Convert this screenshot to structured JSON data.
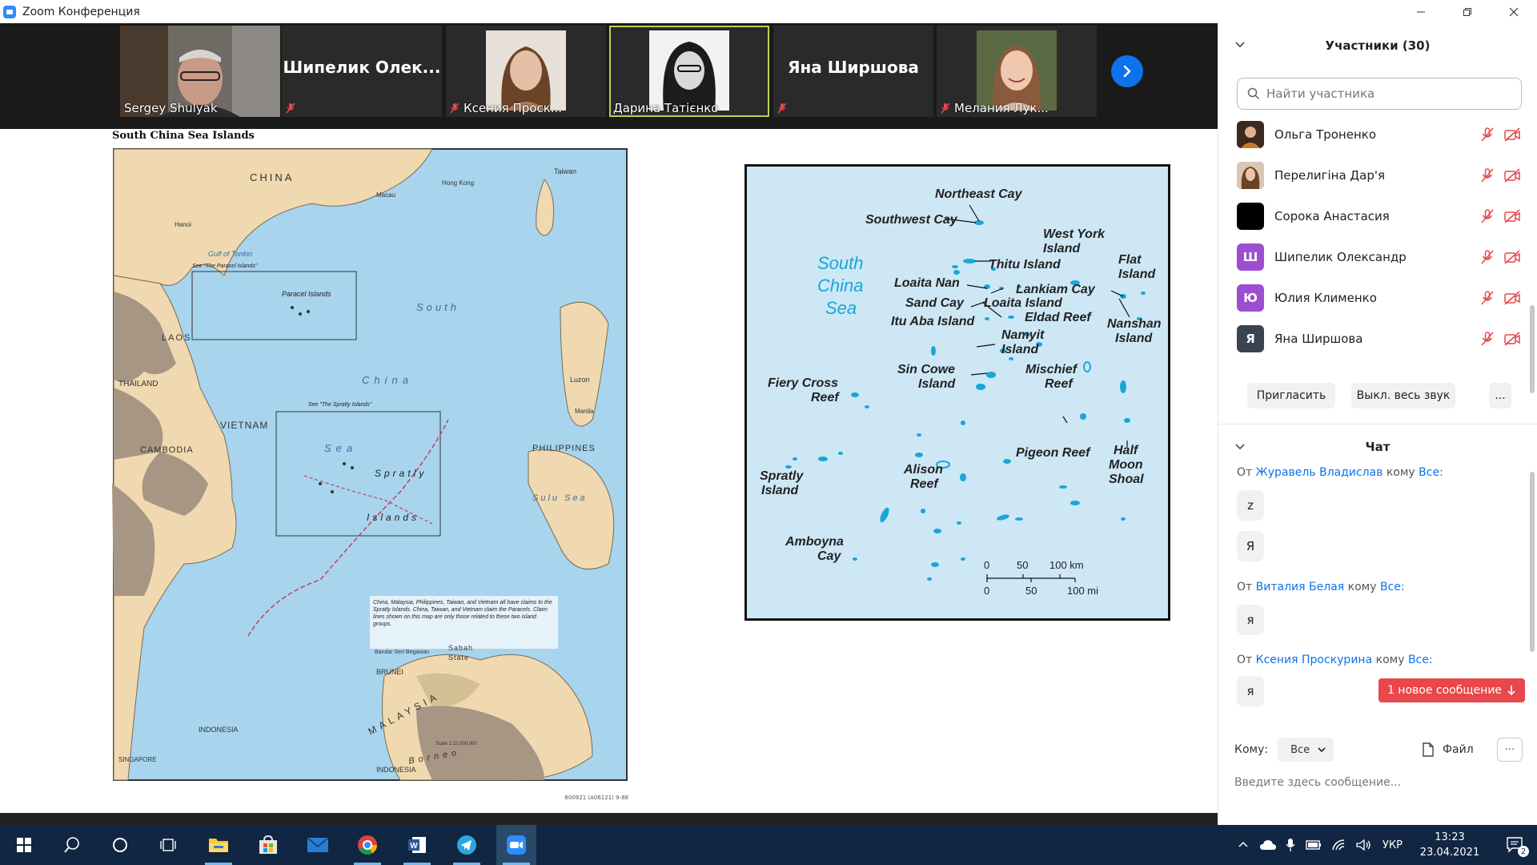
{
  "window": {
    "title": "Zoom Конференция"
  },
  "video_strip": {
    "tiles": [
      {
        "name": "Sergey Shulyak",
        "type": "video"
      },
      {
        "name": "Шипелик  Олек...",
        "type": "name",
        "muted": true
      },
      {
        "name": "Ксения Проск...",
        "type": "video",
        "muted": true
      },
      {
        "name": "Дарина Татієнко",
        "type": "video",
        "active": true
      },
      {
        "name": "Яна Ширшова",
        "type": "name",
        "muted": true
      },
      {
        "name": "Мелания Лук...",
        "type": "video",
        "muted": true
      }
    ]
  },
  "maps": {
    "left_caption": "South China Sea Islands",
    "left_labels": {
      "china": "CHINA",
      "laos": "LAOS",
      "thailand": "THAILAND",
      "vietnam": "VIETNAM",
      "cambodia": "CAMBODIA",
      "philippines": "PHILIPPINES",
      "brunei": "BRUNEI",
      "malaysia": "MALAYSIA",
      "indonesia_left": "INDONESIA",
      "indonesia_bottom": "INDONESIA",
      "singapore": "SINGAPORE",
      "taiwan": "Taiwan",
      "hong_kong": "Hong Kong",
      "macau": "Macau",
      "hanoi": "Hanoi",
      "manila": "Manila",
      "luzon": "Luzon",
      "sabah": "Sabah",
      "sabah_state": "State",
      "paracel": "Paracel Islands",
      "spratly": "Spratly",
      "islands": "Islands",
      "south": "South",
      "china_sea": "China",
      "sea": "Sea",
      "gulf_tonkin": "Gulf of Tonkin",
      "borneo": "Borneo",
      "sulu_sea": "Sulu Sea",
      "bandar": "Bandar Seri Begawan",
      "see_paracel": "See \"The Paracel Islands\"",
      "see_spratly": "See \"The Spratly Islands\"",
      "note": "China, Malaysia, Philippines, Taiwan, and Vietnam all have claims to the Spratly Islands. China, Taiwan, and Vietnam claim the Paracels. Claim lines shown on this map are only those related to these two island groups.",
      "scale": "Scale 1:12,000,000",
      "credit": "800921 (A06121) 9-88"
    },
    "right_labels": {
      "northeast_cay": "Northeast Cay",
      "southwest_cay": "Southwest Cay",
      "west_york": "West York",
      "west_york_2": "Island",
      "south": "South",
      "china": "China",
      "sea": "Sea",
      "thitu": "Thitu Island",
      "flat": "Flat",
      "flat_2": "Island",
      "loaita_nan": "Loaita Nan",
      "lankiam": "Lankiam Cay",
      "loaita_island": "Loaita Island",
      "sand_cay": "Sand Cay",
      "eldad": "Eldad Reef",
      "itu_aba": "Itu Aba Island",
      "nanshan": "Nanshan",
      "nanshan_2": "Island",
      "namyit": "Namyit",
      "namyit_2": "Island",
      "sin_cowe": "Sin Cowe",
      "sin_cowe_2": "Island",
      "mischief": "Mischief",
      "mischief_2": "Reef",
      "fiery_cross": "Fiery Cross",
      "fiery_cross_2": "Reef",
      "pigeon": "Pigeon Reef",
      "half_moon": "Half",
      "half_moon_2": "Moon",
      "half_moon_3": "Shoal",
      "alison": "Alison",
      "alison_2": "Reef",
      "spratly": "Spratly",
      "spratly_2": "Island",
      "amboyna": "Amboyna",
      "amboyna_2": "Cay",
      "scale_km": [
        "0",
        "50",
        "100 km"
      ],
      "scale_mi": [
        "0",
        "50",
        "100 mi"
      ]
    }
  },
  "participants_panel": {
    "title": "Участники (30)",
    "search_placeholder": "Найти участника",
    "participants": [
      {
        "name": "Ольга Троненко",
        "avatar_type": "photo",
        "color": "#8a5a3a"
      },
      {
        "name": "Перелигіна Дар'я",
        "avatar_type": "photo",
        "color": "#6b4e3a"
      },
      {
        "name": "Сорока Анастасия",
        "avatar_type": "solid",
        "color": "#000000"
      },
      {
        "name": "Шипелик Олександр",
        "avatar_type": "letter",
        "letter": "Ш",
        "color": "#9b4fd0"
      },
      {
        "name": "Юлия Клименко",
        "avatar_type": "letter",
        "letter": "Ю",
        "color": "#9b4fd0"
      },
      {
        "name": "Яна Ширшова",
        "avatar_type": "letter",
        "letter": "Я",
        "color": "#3a4450"
      }
    ],
    "invite_label": "Пригласить",
    "mute_all_label": "Выкл. весь звук",
    "more_label": "..."
  },
  "chat": {
    "title": "Чат",
    "from_word": "От",
    "to_word": "кому",
    "messages": [
      {
        "sender": "Журавель Владислав",
        "recipient": "Все:",
        "bubbles": [
          "z",
          "Я"
        ]
      },
      {
        "sender": "Виталия Белая",
        "recipient": "Все:",
        "bubbles": [
          "я"
        ]
      },
      {
        "sender": "Ксения Проскурина",
        "recipient": "Все:",
        "bubbles": [
          "я"
        ]
      }
    ],
    "new_message_label": "1 новое сообщение",
    "to_label": "Кому:",
    "to_value": "Все",
    "file_label": "Файл",
    "more_label": "···",
    "input_placeholder": "Введите здесь сообщение..."
  },
  "taskbar": {
    "lang": "УКР",
    "time": "13:23",
    "date": "23.04.2021",
    "notification_count": "2"
  },
  "colors": {
    "zoom_blue": "#0e72ed",
    "new_msg_red": "#e8474b",
    "active_speaker": "#b8d34e",
    "taskbar": "#102642",
    "sea": "#a8d4ee",
    "land": "#f0d9b0"
  }
}
